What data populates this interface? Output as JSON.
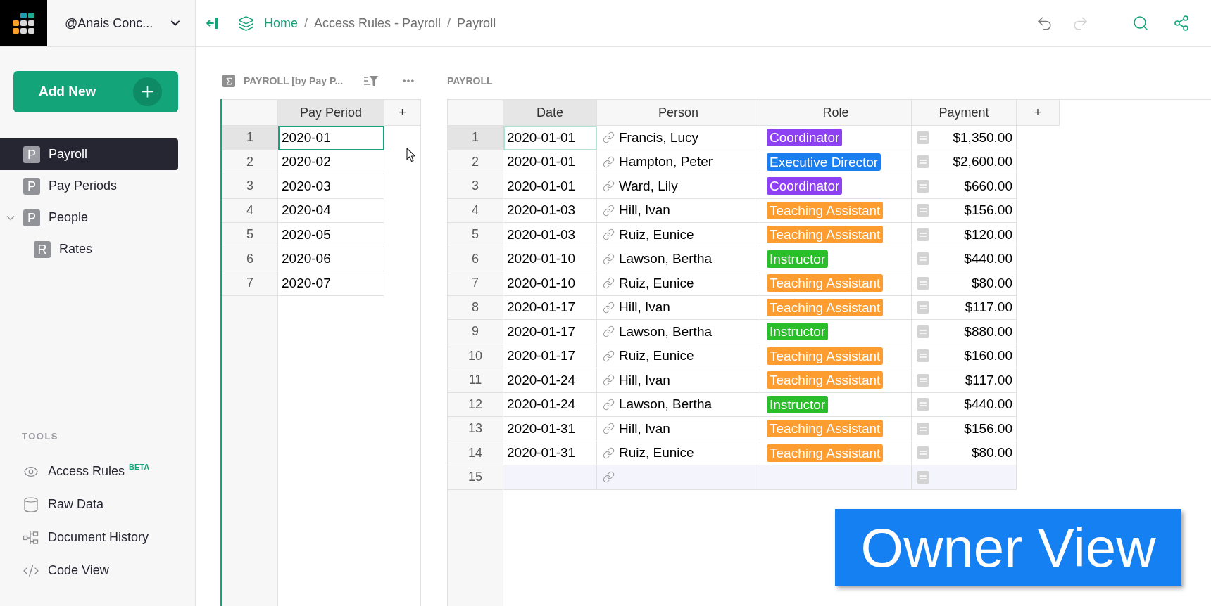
{
  "workspace": {
    "name": "@Anais Conc..."
  },
  "breadcrumb": [
    {
      "kind": "link",
      "text": "Home"
    },
    {
      "kind": "separator",
      "text": "/"
    },
    {
      "kind": "link",
      "text": "Access Rules - Payroll"
    },
    {
      "kind": "separator",
      "text": "/"
    },
    {
      "kind": "current",
      "text": "Payroll"
    }
  ],
  "toolbar": {
    "undo": {
      "disabled": false
    },
    "redo": {
      "disabled": true
    }
  },
  "sidebar": {
    "add_button": "Add New",
    "pages": [
      {
        "letter": "P",
        "label": "Payroll",
        "selected": true
      },
      {
        "letter": "P",
        "label": "Pay Periods",
        "selected": false
      },
      {
        "letter": "P",
        "label": "People",
        "selected": false,
        "expanded": true,
        "children": [
          {
            "letter": "R",
            "label": "Rates",
            "selected": false
          }
        ]
      }
    ],
    "tools_heading": "TOOLS",
    "tools": [
      {
        "label": "Access Rules",
        "badge": "BETA"
      },
      {
        "label": "Raw Data"
      },
      {
        "label": "Document History"
      },
      {
        "label": "Code View"
      }
    ]
  },
  "summary_section": {
    "title": "PAYROLL [by Pay P...",
    "focused": true,
    "columns": [
      {
        "label": "Pay Period",
        "selected": true
      }
    ],
    "add_column": "+",
    "rows": [
      {
        "number": "1",
        "selected": true,
        "pay_period": "2020-01"
      },
      {
        "number": "2",
        "selected": false,
        "pay_period": "2020-02"
      },
      {
        "number": "3",
        "selected": false,
        "pay_period": "2020-03"
      },
      {
        "number": "4",
        "selected": false,
        "pay_period": "2020-04"
      },
      {
        "number": "5",
        "selected": false,
        "pay_period": "2020-05"
      },
      {
        "number": "6",
        "selected": false,
        "pay_period": "2020-06"
      },
      {
        "number": "7",
        "selected": false,
        "pay_period": "2020-07"
      }
    ]
  },
  "payroll_section": {
    "title": "PAYROLL",
    "focused": false,
    "columns": [
      {
        "label": "Date",
        "selected": true
      },
      {
        "label": "Person",
        "selected": false
      },
      {
        "label": "Role",
        "selected": false
      },
      {
        "label": "Payment",
        "selected": false
      }
    ],
    "add_column": "+",
    "rows": [
      {
        "kind": "record",
        "number": "1",
        "selected": true,
        "date": "2020-01-01",
        "person": "Francis, Lucy",
        "role": {
          "label": "Coordinator",
          "color": "#8e40f3"
        },
        "payment": "$1,350.00"
      },
      {
        "kind": "record",
        "number": "2",
        "selected": false,
        "date": "2020-01-01",
        "person": "Hampton, Peter",
        "role": {
          "label": "Executive Director",
          "color": "#1a7df0"
        },
        "payment": "$2,600.00"
      },
      {
        "kind": "record",
        "number": "3",
        "selected": false,
        "date": "2020-01-01",
        "person": "Ward, Lily",
        "role": {
          "label": "Coordinator",
          "color": "#8e40f3"
        },
        "payment": "$660.00"
      },
      {
        "kind": "record",
        "number": "4",
        "selected": false,
        "date": "2020-01-03",
        "person": "Hill, Ivan",
        "role": {
          "label": "Teaching Assistant",
          "color": "#fd9c2f"
        },
        "payment": "$156.00"
      },
      {
        "kind": "record",
        "number": "5",
        "selected": false,
        "date": "2020-01-03",
        "person": "Ruiz, Eunice",
        "role": {
          "label": "Teaching Assistant",
          "color": "#fd9c2f"
        },
        "payment": "$120.00"
      },
      {
        "kind": "record",
        "number": "6",
        "selected": false,
        "date": "2020-01-10",
        "person": "Lawson, Bertha",
        "role": {
          "label": "Instructor",
          "color": "#2abf2a"
        },
        "payment": "$440.00"
      },
      {
        "kind": "record",
        "number": "7",
        "selected": false,
        "date": "2020-01-10",
        "person": "Ruiz, Eunice",
        "role": {
          "label": "Teaching Assistant",
          "color": "#fd9c2f"
        },
        "payment": "$80.00"
      },
      {
        "kind": "record",
        "number": "8",
        "selected": false,
        "date": "2020-01-17",
        "person": "Hill, Ivan",
        "role": {
          "label": "Teaching Assistant",
          "color": "#fd9c2f"
        },
        "payment": "$117.00"
      },
      {
        "kind": "record",
        "number": "9",
        "selected": false,
        "date": "2020-01-17",
        "person": "Lawson, Bertha",
        "role": {
          "label": "Instructor",
          "color": "#2abf2a"
        },
        "payment": "$880.00"
      },
      {
        "kind": "record",
        "number": "10",
        "selected": false,
        "date": "2020-01-17",
        "person": "Ruiz, Eunice",
        "role": {
          "label": "Teaching Assistant",
          "color": "#fd9c2f"
        },
        "payment": "$160.00"
      },
      {
        "kind": "record",
        "number": "11",
        "selected": false,
        "date": "2020-01-24",
        "person": "Hill, Ivan",
        "role": {
          "label": "Teaching Assistant",
          "color": "#fd9c2f"
        },
        "payment": "$117.00"
      },
      {
        "kind": "record",
        "number": "12",
        "selected": false,
        "date": "2020-01-24",
        "person": "Lawson, Bertha",
        "role": {
          "label": "Instructor",
          "color": "#2abf2a"
        },
        "payment": "$440.00"
      },
      {
        "kind": "record",
        "number": "13",
        "selected": false,
        "date": "2020-01-31",
        "person": "Hill, Ivan",
        "role": {
          "label": "Teaching Assistant",
          "color": "#fd9c2f"
        },
        "payment": "$156.00"
      },
      {
        "kind": "record",
        "number": "14",
        "selected": false,
        "date": "2020-01-31",
        "person": "Ruiz, Eunice",
        "role": {
          "label": "Teaching Assistant",
          "color": "#fd9c2f"
        },
        "payment": "$80.00"
      },
      {
        "kind": "new",
        "number": "15",
        "selected": false
      }
    ]
  },
  "caption": "Owner View"
}
